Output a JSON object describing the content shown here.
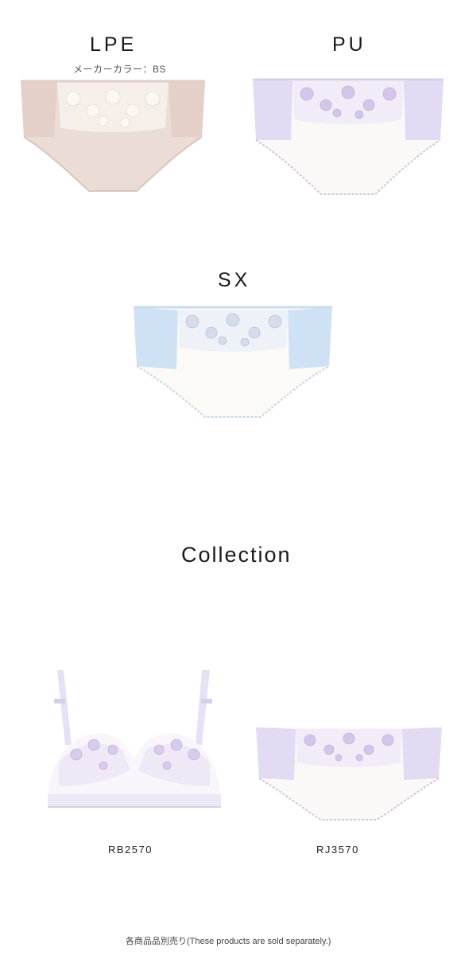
{
  "variants": [
    {
      "code": "LPE",
      "maker_color": "メーカーカラー：BS",
      "fabric": "#ecdcd6",
      "side": "#e6d3cc",
      "lace": "#faf6f2",
      "flower": "#f3ecea"
    },
    {
      "code": "PU",
      "fabric": "#fbf9f7",
      "side": "#e6def4",
      "lace": "#efe9f7",
      "flower": "#c6b4dc"
    },
    {
      "code": "SX",
      "fabric": "#fbfaf6",
      "side": "#cfe2f5",
      "lace": "#eef2f8",
      "flower": "#b9c4dc"
    }
  ],
  "collection": {
    "title": "Collection",
    "items": [
      {
        "code": "RB2570",
        "type": "bra"
      },
      {
        "code": "RJ3570",
        "type": "panty"
      }
    ]
  },
  "footnote": "各商品品別売り(These products are sold separately.)"
}
